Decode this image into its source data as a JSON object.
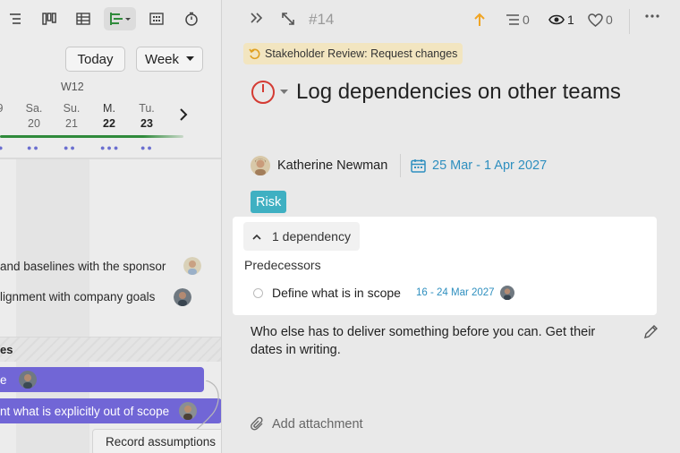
{
  "timeline": {
    "today_label": "Today",
    "range_label": "Week",
    "week_label": "W12",
    "days": [
      {
        "weekday": "",
        "date": "9"
      },
      {
        "weekday": "Sa.",
        "date": "20"
      },
      {
        "weekday": "Su.",
        "date": "21"
      },
      {
        "weekday": "M.",
        "date": "22"
      },
      {
        "weekday": "Tu.",
        "date": "23"
      }
    ],
    "rows": [
      {
        "text": "and baselines with the sponsor"
      },
      {
        "text": "lignment with company goals"
      }
    ],
    "group_label": "es",
    "bars": [
      {
        "text": "e"
      },
      {
        "text": "nt what is explicitly out of scope"
      }
    ],
    "record_label": "Record assumptions",
    "accent_color": "#7166d6"
  },
  "task": {
    "id": "#14",
    "counts": {
      "subtasks": "0",
      "watchers": "1",
      "likes": "0"
    },
    "status_badge": "Stakeholder Review: Request changes",
    "title": "Log dependencies on other teams",
    "assignee": "Katherine Newman",
    "date_range": "25 Mar - 1 Apr 2027",
    "tag": "Risk",
    "dependencies": {
      "toggle_label": "1 dependency",
      "section_label": "Predecessors",
      "items": [
        {
          "name": "Define what is in scope",
          "dates": "16 - 24 Mar 2027"
        }
      ]
    },
    "description": "Who else has to deliver something before you can. Get their dates in writing.",
    "attachment_label": "Add attachment"
  }
}
